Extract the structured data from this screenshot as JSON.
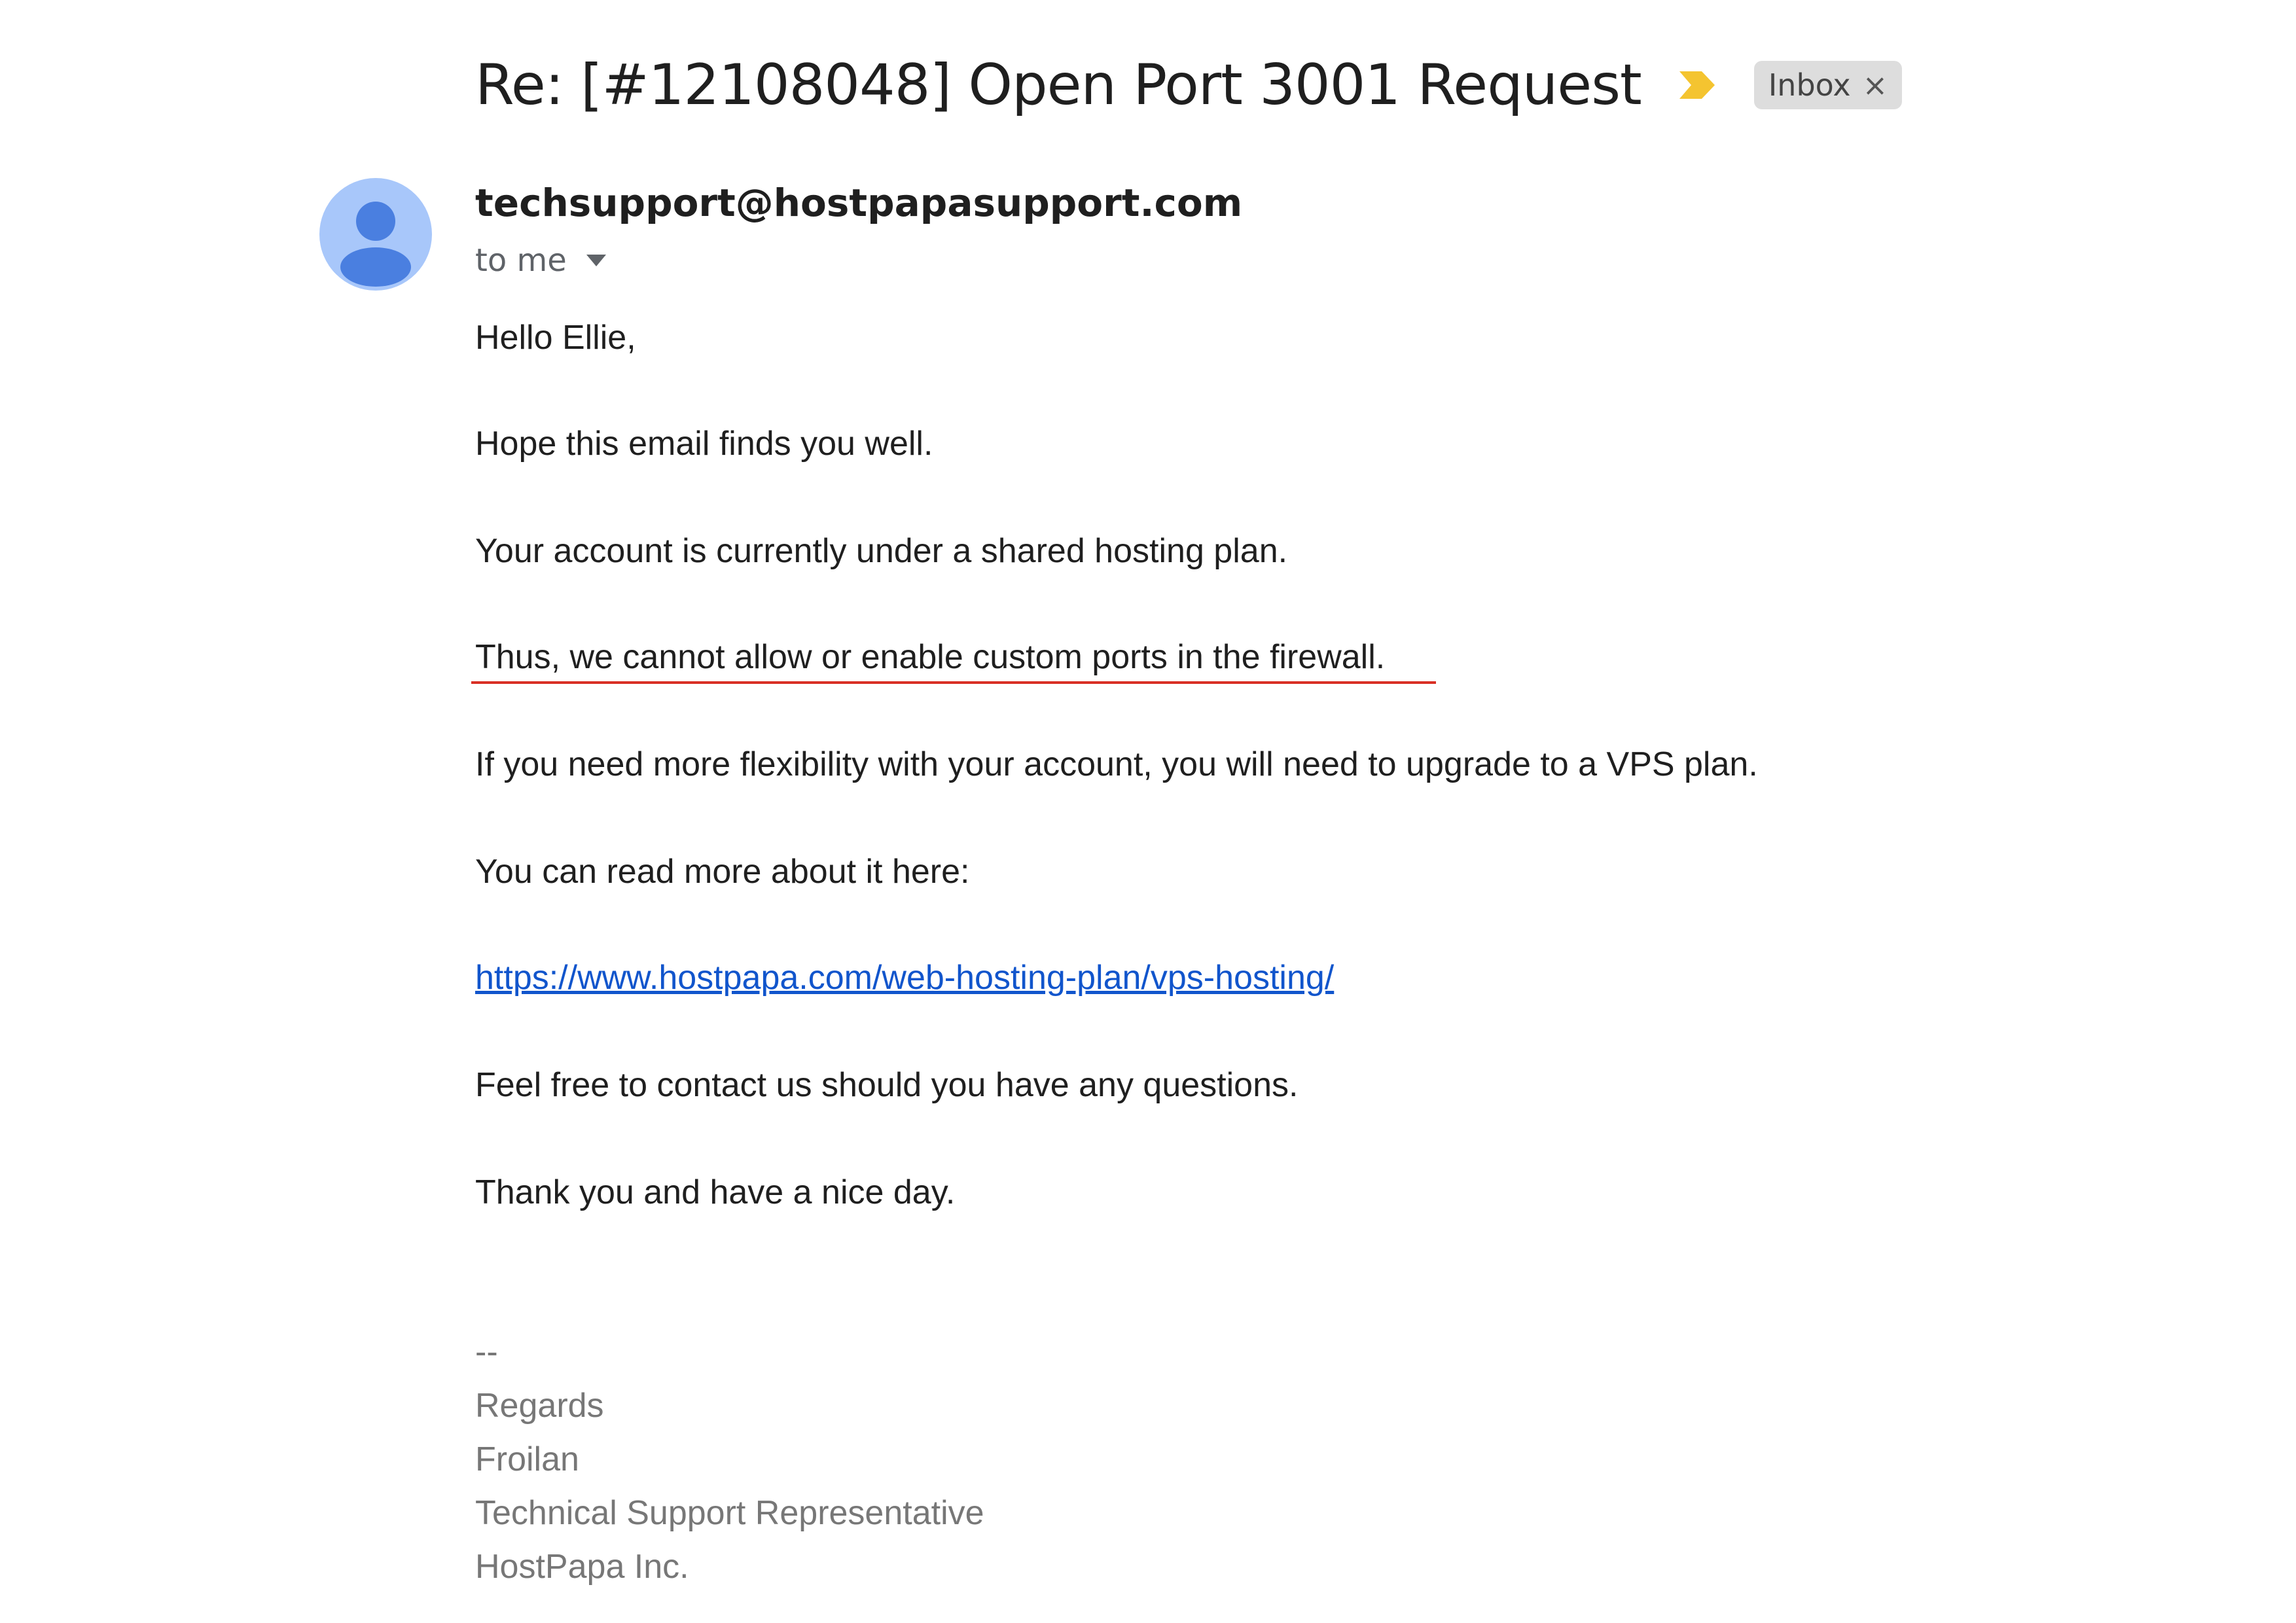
{
  "email": {
    "subject": "Re: [#12108048] Open Port 3001 Request",
    "label": "Inbox",
    "label_remove": "×",
    "importance_color": "#f4c430",
    "sender": "techsupport@hostpapasupport.com",
    "recipient": "to me",
    "avatar_color": "#a8c7fa",
    "avatar_figure_color": "#4a7fe0"
  },
  "body": {
    "greeting": "Hello Ellie,",
    "line1": "Hope this email finds you well.",
    "line2": "Your account is currently under a shared hosting plan.",
    "line3": "Thus, we cannot allow or enable custom ports in the firewall.",
    "line4": "If you need more flexibility with your account, you will need to upgrade to a VPS plan.",
    "line5": "You can read more about it here:",
    "link": "https://www.hostpapa.com/web-hosting-plan/vps-hosting/",
    "line6": "Feel free to contact us should you have any questions.",
    "line7": "Thank you and have a nice day."
  },
  "signature": {
    "separator": "--",
    "regards": "Regards",
    "name": "Froilan",
    "title": "Technical Support Representative",
    "company": "HostPapa Inc."
  }
}
